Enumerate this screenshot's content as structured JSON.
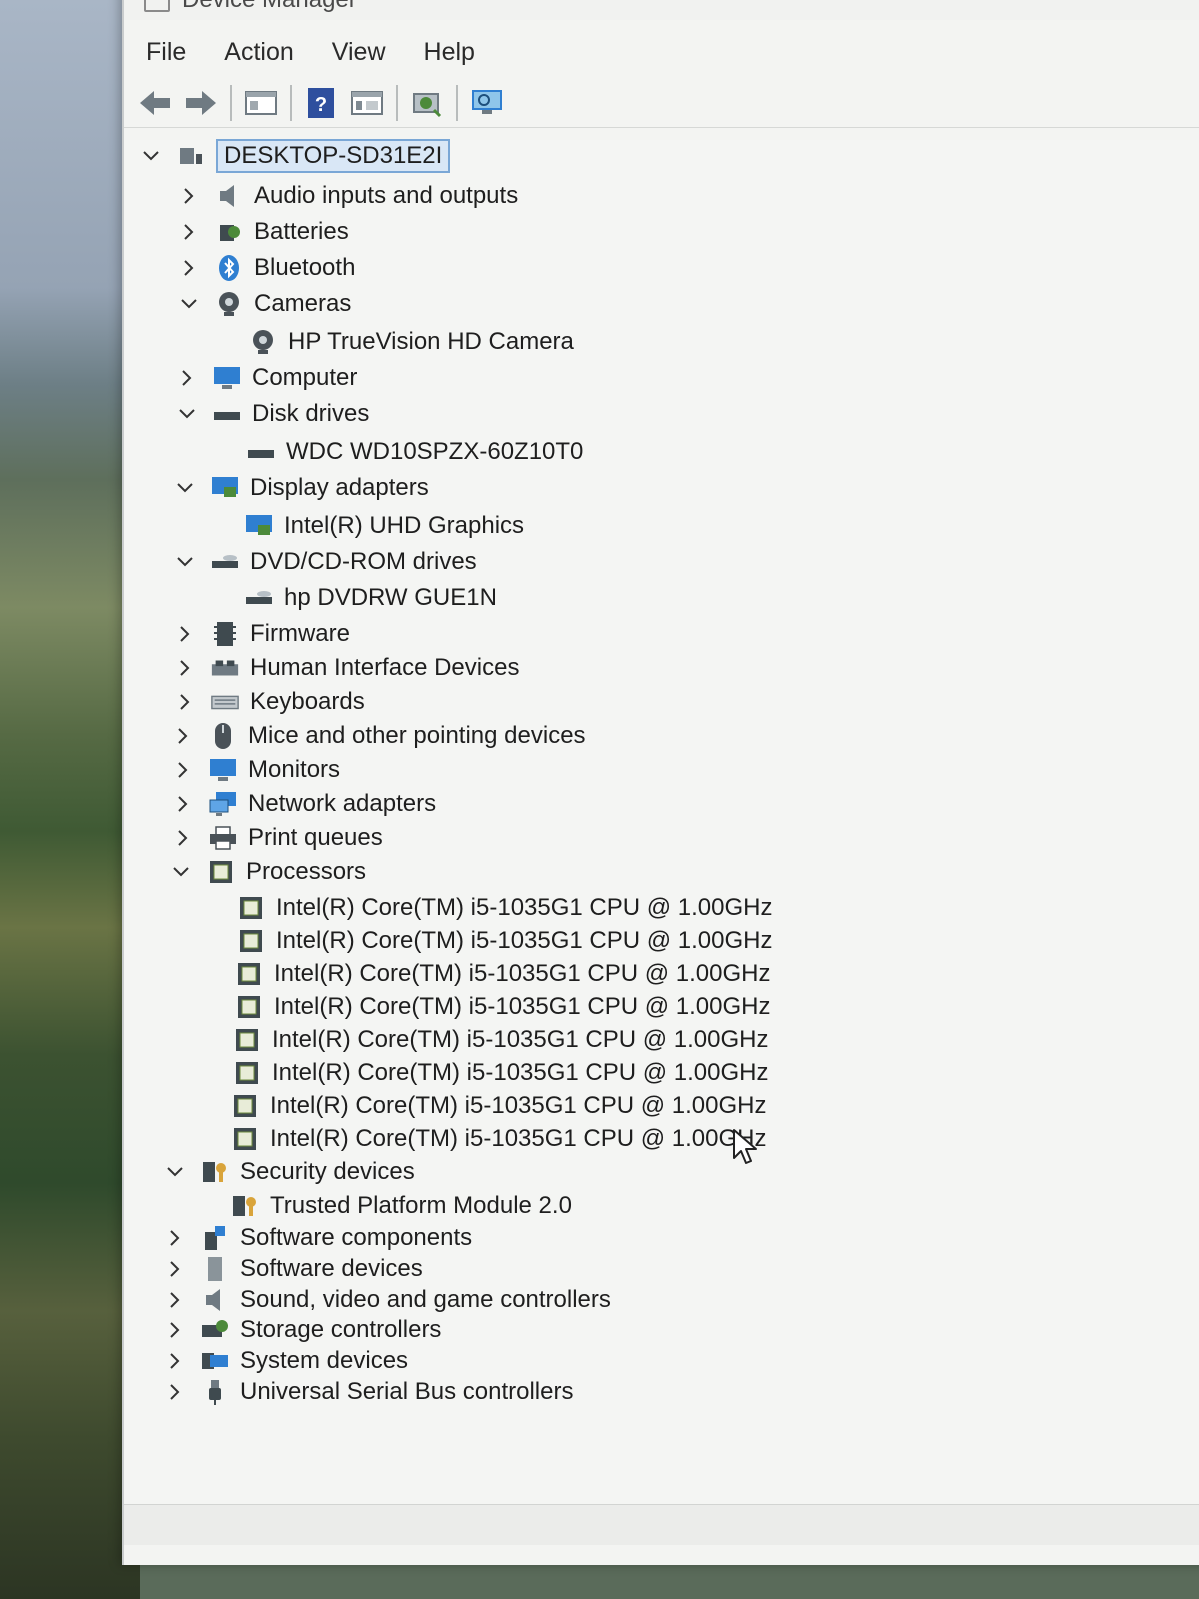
{
  "window": {
    "title": "Device Manager"
  },
  "menu": [
    "File",
    "Action",
    "View",
    "Help"
  ],
  "toolbar": {
    "buttons": [
      "back-arrow-icon",
      "forward-arrow-icon",
      "properties-icon",
      "help-icon",
      "view-icon",
      "update-driver-icon",
      "scan-hardware-icon"
    ]
  },
  "tree": {
    "root": "DESKTOP-SD31E2I",
    "categories": {
      "audio": "Audio inputs and outputs",
      "batteries": "Batteries",
      "bluetooth": "Bluetooth",
      "cameras": "Cameras",
      "camera_device": "HP TrueVision HD Camera",
      "computer": "Computer",
      "disk": "Disk drives",
      "disk_device": "WDC WD10SPZX-60Z10T0",
      "display": "Display adapters",
      "display_device": "Intel(R) UHD Graphics",
      "dvd": "DVD/CD-ROM drives",
      "dvd_device": "hp DVDRW GUE1N",
      "firmware": "Firmware",
      "hid": "Human Interface Devices",
      "keyboards": "Keyboards",
      "mice": "Mice and other pointing devices",
      "monitors": "Monitors",
      "network": "Network adapters",
      "print": "Print queues",
      "processors": "Processors",
      "cpu": "Intel(R) Core(TM) i5-1035G1 CPU @ 1.00GHz",
      "security": "Security devices",
      "security_device": "Trusted Platform Module 2.0",
      "software_components": "Software components",
      "software_devices": "Software devices",
      "sound": "Sound, video and game controllers",
      "storage": "Storage controllers",
      "system": "System devices",
      "usb": "Universal Serial Bus controllers"
    }
  },
  "colors": {
    "window_bg": "#f4f5f3",
    "selection_bg": "#d9e7f6",
    "selection_border": "#7aa7d6",
    "icon_blue": "#2f7fd1",
    "icon_green": "#4c8a3a"
  }
}
